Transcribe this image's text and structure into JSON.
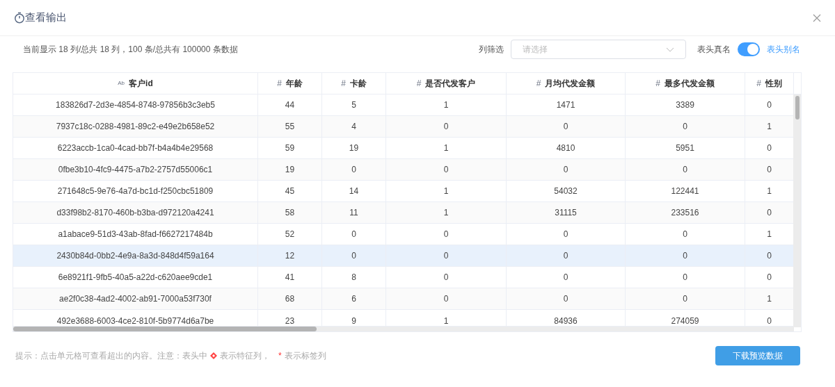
{
  "window": {
    "title": "查看输出"
  },
  "summary": "当前显示 18 列/总共 18 列，100 条/总共有 100000 条数据",
  "filter": {
    "label": "列筛选",
    "placeholder": "请选择"
  },
  "header_toggle": {
    "off_label": "表头真名",
    "on_label": "表头别名",
    "on": true
  },
  "table": {
    "columns": [
      {
        "type_mark": "Ab",
        "label": "客户id"
      },
      {
        "type_mark": "#",
        "label": "年龄"
      },
      {
        "type_mark": "#",
        "label": "卡龄"
      },
      {
        "type_mark": "#",
        "label": "是否代发客户"
      },
      {
        "type_mark": "#",
        "label": "月均代发金额"
      },
      {
        "type_mark": "#",
        "label": "最多代发金额"
      },
      {
        "type_mark": "#",
        "label": "性别"
      }
    ],
    "rows": [
      {
        "selected": false,
        "cells": [
          "183826d7-2d3e-4854-8748-97856b3c3eb5",
          "44",
          "5",
          "1",
          "1471",
          "3389",
          "0"
        ]
      },
      {
        "selected": false,
        "cells": [
          "7937c18c-0288-4981-89c2-e49e2b658e52",
          "55",
          "4",
          "0",
          "0",
          "0",
          "1"
        ]
      },
      {
        "selected": false,
        "cells": [
          "6223accb-1ca0-4cad-bb7f-b4a4b4e29568",
          "59",
          "19",
          "1",
          "4810",
          "5951",
          "0"
        ]
      },
      {
        "selected": false,
        "cells": [
          "0fbe3b10-4fc9-4475-a7b2-2757d55006c1",
          "19",
          "0",
          "0",
          "0",
          "0",
          "0"
        ]
      },
      {
        "selected": false,
        "cells": [
          "271648c5-9e76-4a7d-bc1d-f250cbc51809",
          "45",
          "14",
          "1",
          "54032",
          "122441",
          "1"
        ]
      },
      {
        "selected": false,
        "cells": [
          "d33f98b2-8170-460b-b3ba-d972120a4241",
          "58",
          "11",
          "1",
          "31115",
          "233516",
          "0"
        ]
      },
      {
        "selected": false,
        "cells": [
          "a1abace9-51d3-43ab-8fad-f6627217484b",
          "52",
          "0",
          "0",
          "0",
          "0",
          "1"
        ]
      },
      {
        "selected": true,
        "cells": [
          "2430b84d-0bb2-4e9a-8a3d-848d4f59a164",
          "12",
          "0",
          "0",
          "0",
          "0",
          "0"
        ]
      },
      {
        "selected": false,
        "cells": [
          "6e8921f1-9fb5-40a5-a22d-c620aee9cde1",
          "41",
          "8",
          "0",
          "0",
          "0",
          "0"
        ]
      },
      {
        "selected": false,
        "cells": [
          "ae2f0c38-4ad2-4002-ab91-7000a53f730f",
          "68",
          "6",
          "0",
          "0",
          "0",
          "1"
        ]
      },
      {
        "selected": false,
        "cells": [
          "492e3688-6003-4ce2-810f-5b9774d6a7be",
          "23",
          "9",
          "1",
          "84936",
          "274059",
          "0"
        ]
      }
    ]
  },
  "hint": {
    "before": "提示：点击单元格可查看超出的内容。注意：表头中",
    "feature": "表示特征列，",
    "star": "*",
    "label": "表示标签列"
  },
  "download_button": "下载预览数据"
}
